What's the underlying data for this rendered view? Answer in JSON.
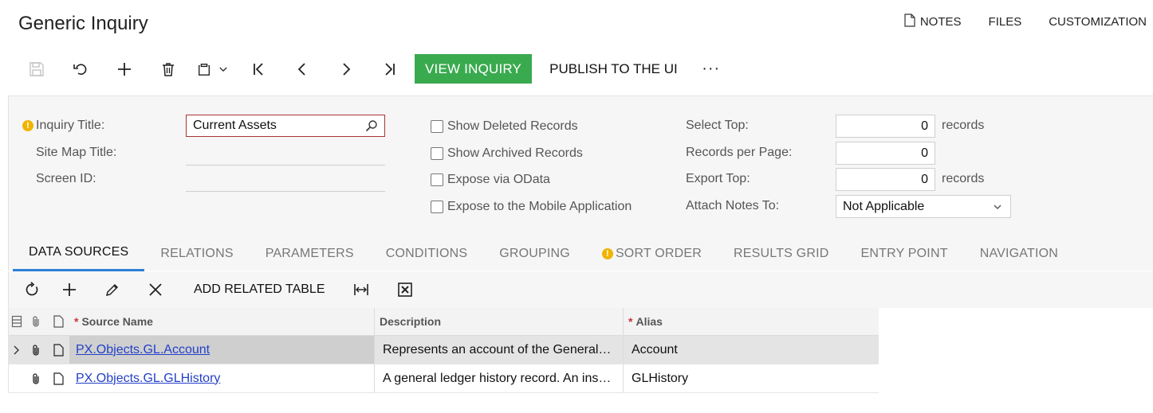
{
  "header": {
    "title": "Generic Inquiry",
    "links": [
      "NOTES",
      "FILES",
      "CUSTOMIZATION"
    ]
  },
  "toolbar": {
    "view_inquiry": "VIEW INQUIRY",
    "publish": "PUBLISH TO THE UI",
    "more": "···"
  },
  "form": {
    "inquiry_title_label": "Inquiry Title:",
    "inquiry_title_value": "Current Assets",
    "site_map_title_label": "Site Map Title:",
    "screen_id_label": "Screen ID:",
    "show_deleted": "Show Deleted Records",
    "show_archived": "Show Archived Records",
    "expose_odata": "Expose via OData",
    "expose_mobile": "Expose to the Mobile Application",
    "select_top_label": "Select Top:",
    "select_top_value": "0",
    "records_per_page_label": "Records per Page:",
    "records_per_page_value": "0",
    "export_top_label": "Export Top:",
    "export_top_value": "0",
    "records_suffix": "records",
    "attach_notes_label": "Attach Notes To:",
    "attach_notes_value": "Not Applicable"
  },
  "tabs": [
    {
      "label": "DATA SOURCES"
    },
    {
      "label": "RELATIONS"
    },
    {
      "label": "PARAMETERS"
    },
    {
      "label": "CONDITIONS"
    },
    {
      "label": "GROUPING"
    },
    {
      "label": "SORT ORDER"
    },
    {
      "label": "RESULTS GRID"
    },
    {
      "label": "ENTRY POINT"
    },
    {
      "label": "NAVIGATION"
    }
  ],
  "grid_toolbar": {
    "add_related_table": "ADD RELATED TABLE"
  },
  "grid": {
    "columns": {
      "source_name": "Source Name",
      "description": "Description",
      "alias": "Alias"
    },
    "required_mark": "*",
    "rows": [
      {
        "source_name": "PX.Objects.GL.Account",
        "description": "Represents an account of the General…",
        "alias": "Account"
      },
      {
        "source_name": "PX.Objects.GL.GLHistory",
        "description": "A general ledger history record. An ins…",
        "alias": "GLHistory"
      }
    ]
  },
  "colors": {
    "accent_green": "#3aaa4f",
    "tab_underline": "#2d7fd8",
    "warning": "#f0b400",
    "link": "#2340c8"
  }
}
